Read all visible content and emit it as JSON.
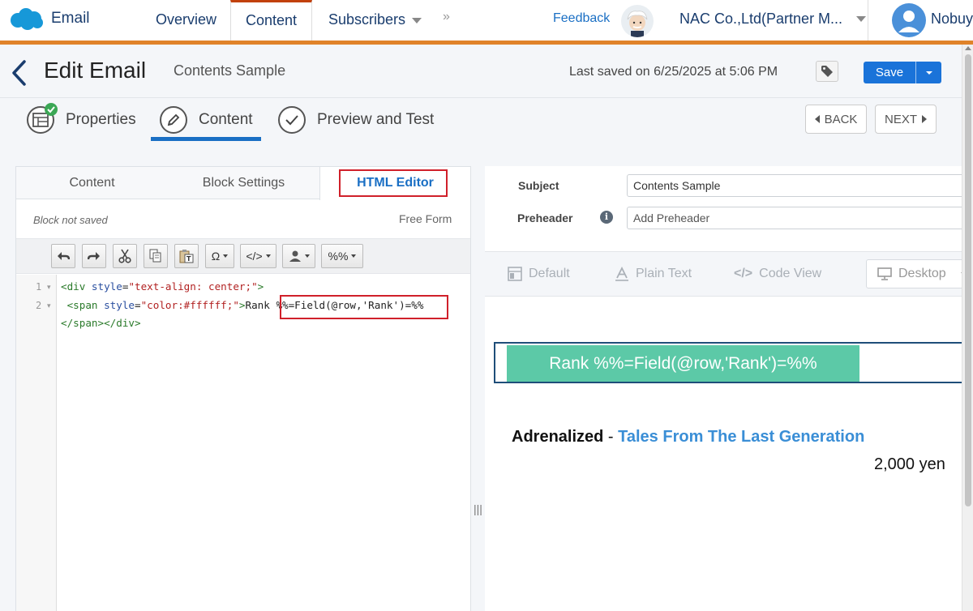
{
  "app": {
    "brand": "Email",
    "nav": {
      "overview": "Overview",
      "content": "Content",
      "subscribers": "Subscribers",
      "more": "»",
      "feedback": "Feedback",
      "org": "NAC Co.,Ltd(Partner M...",
      "user": "Nobuy"
    }
  },
  "header": {
    "title": "Edit Email",
    "subtitle": "Contents Sample",
    "last_saved": "Last saved on 6/25/2025 at 5:06 PM",
    "save_label": "Save"
  },
  "steps": {
    "items": [
      {
        "label": "Properties",
        "icon": "table-check-icon"
      },
      {
        "label": "Content",
        "icon": "pencil-icon"
      },
      {
        "label": "Preview and Test",
        "icon": "check-circle-icon"
      }
    ],
    "back": "BACK",
    "next": "NEXT"
  },
  "editor": {
    "tabs": [
      "Content",
      "Block Settings",
      "HTML Editor"
    ],
    "active_tab": "HTML Editor",
    "block_status": "Block not saved",
    "mode": "Free Form",
    "toolbar": {
      "omega": "Ω",
      "code": "</>",
      "personalize": "%%"
    },
    "line_numbers": [
      "1",
      "2"
    ],
    "code_lines": {
      "l1_open": "<div ",
      "l1_attr": "style",
      "l1_eq": "=",
      "l1_val": "\"text-align: center;\"",
      "l1_close": ">",
      "l2_open": " <span ",
      "l2_attr": "style",
      "l2_eq": "=",
      "l2_val": "\"color:#ffffff;\"",
      "l2_close": ">",
      "l2_text": "Rank ",
      "l2_expr": "%%=Field(@row,'Rank')=%%",
      "l3": "</span></div>"
    }
  },
  "fields": {
    "subject_label": "Subject",
    "subject_value": "Contents Sample",
    "preheader_label": "Preheader",
    "preheader_placeholder": "Add Preheader",
    "info": "i"
  },
  "view": {
    "default": "Default",
    "plain_text": "Plain Text",
    "code_view": "Code View",
    "device": "Desktop"
  },
  "preview": {
    "rank_text": "Rank %%=Field(@row,'Rank')=%%",
    "artist": "Adrenalized",
    "separator": " - ",
    "song": "Tales From The Last Generation",
    "price": "2,000 yen"
  },
  "colors": {
    "accent": "#1a6fc4",
    "nav_bar": "#e0832a",
    "rank_bg": "#5cc9a7",
    "highlight": "#d0202a",
    "save": "#1a73d9"
  }
}
